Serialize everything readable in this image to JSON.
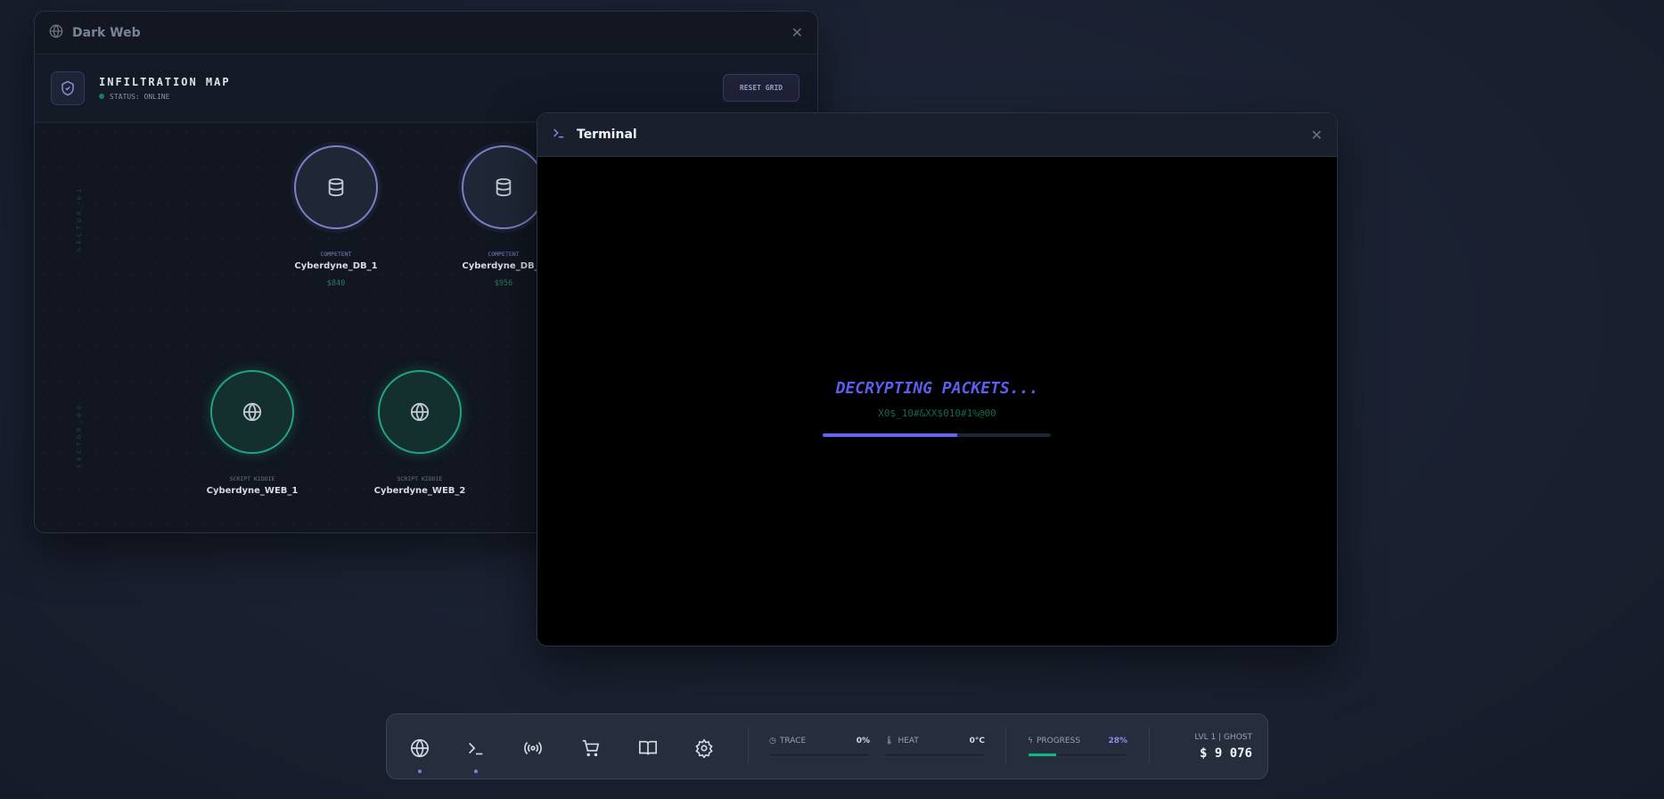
{
  "darkweb": {
    "title": "Dark Web",
    "icon": "globe-icon",
    "map_title": "INFILTRATION MAP",
    "status": "STATUS: ONLINE",
    "reset_label": "RESET GRID",
    "sectors": [
      "SECTOR_01",
      "SECTOR_00"
    ],
    "nodes": [
      {
        "tier": "COMPETENT",
        "name": "Cyberdyne_DB_1",
        "price": "$840",
        "icon": "database-icon"
      },
      {
        "tier": "COMPETENT",
        "name": "Cyberdyne_DB_2",
        "price": "$956",
        "icon": "database-icon"
      },
      {
        "tier": "SCRIPT KIDDIE",
        "name": "Cyberdyne_WEB_1",
        "icon": "globe-icon"
      },
      {
        "tier": "SCRIPT KIDDIE",
        "name": "Cyberdyne_WEB_2",
        "icon": "globe-icon"
      }
    ]
  },
  "terminal": {
    "title": "Terminal",
    "message": "DECRYPTING PACKETS...",
    "noise": "X0$_10#&XX$010#1%@00",
    "progress_percent": 59
  },
  "taskbar": {
    "apps": [
      {
        "name": "globe-icon",
        "active": true
      },
      {
        "name": "terminal-icon",
        "active": true
      },
      {
        "name": "broadcast-icon",
        "active": false
      },
      {
        "name": "cart-icon",
        "active": false
      },
      {
        "name": "book-icon",
        "active": false
      },
      {
        "name": "settings-icon",
        "active": false
      }
    ],
    "trace": {
      "label": "TRACE",
      "value": "0%",
      "percent": 0
    },
    "heat": {
      "label": "HEAT",
      "value": "0°C",
      "percent": 0
    },
    "progress": {
      "label": "PROGRESS",
      "value": "28%",
      "percent": 28
    },
    "level": "LVL 1 | GHOST",
    "money": "$ 9 076"
  },
  "colors": {
    "accent": "#6366f1",
    "success": "#10b981",
    "node_db": "#7c80c8",
    "node_web": "#22a382"
  }
}
